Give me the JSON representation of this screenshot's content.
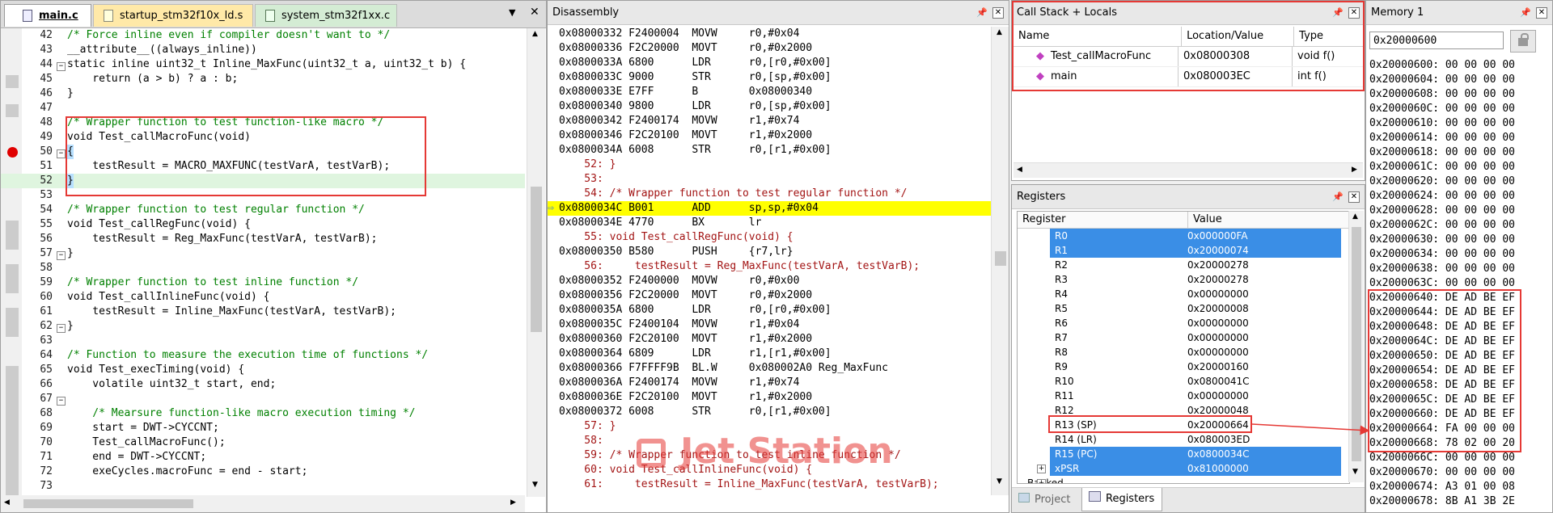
{
  "editor": {
    "tabs": [
      {
        "label": "main.c",
        "active": true
      },
      {
        "label": "startup_stm32f10x_ld.s",
        "active": false
      },
      {
        "label": "system_stm32f1xx.c",
        "active": false
      }
    ],
    "lines": [
      {
        "n": "42",
        "text": "/* Force inline even if compiler doesn't want to */"
      },
      {
        "n": "43",
        "text": "__attribute__((always_inline))"
      },
      {
        "n": "44",
        "text": "static inline uint32_t Inline_MaxFunc(uint32_t a, uint32_t b) {"
      },
      {
        "n": "45",
        "text": "    return (a > b) ? a : b;"
      },
      {
        "n": "46",
        "text": "}"
      },
      {
        "n": "47",
        "text": ""
      },
      {
        "n": "48",
        "text": "/* Wrapper function to test function-like macro */"
      },
      {
        "n": "49",
        "text": "void Test_callMacroFunc(void)"
      },
      {
        "n": "50",
        "text": "{"
      },
      {
        "n": "51",
        "text": "    testResult = MACRO_MAXFUNC(testVarA, testVarB);"
      },
      {
        "n": "52",
        "text": "}"
      },
      {
        "n": "53",
        "text": ""
      },
      {
        "n": "54",
        "text": "/* Wrapper function to test regular function */"
      },
      {
        "n": "55",
        "text": "void Test_callRegFunc(void) {"
      },
      {
        "n": "56",
        "text": "    testResult = Reg_MaxFunc(testVarA, testVarB);"
      },
      {
        "n": "57",
        "text": "}"
      },
      {
        "n": "58",
        "text": ""
      },
      {
        "n": "59",
        "text": "/* Wrapper function to test inline function */"
      },
      {
        "n": "60",
        "text": "void Test_callInlineFunc(void) {"
      },
      {
        "n": "61",
        "text": "    testResult = Inline_MaxFunc(testVarA, testVarB);"
      },
      {
        "n": "62",
        "text": "}"
      },
      {
        "n": "63",
        "text": ""
      },
      {
        "n": "64",
        "text": "/* Function to measure the execution time of functions */"
      },
      {
        "n": "65",
        "text": "void Test_execTiming(void) {"
      },
      {
        "n": "66",
        "text": "    volatile uint32_t start, end;"
      },
      {
        "n": "67",
        "text": ""
      },
      {
        "n": "68",
        "text": "    /* Mearsure function-like macro execution timing */"
      },
      {
        "n": "69",
        "text": "    start = DWT->CYCCNT;"
      },
      {
        "n": "70",
        "text": "    Test_callMacroFunc();"
      },
      {
        "n": "71",
        "text": "    end = DWT->CYCCNT;"
      },
      {
        "n": "72",
        "text": "    exeCycles.macroFunc = end - start;"
      },
      {
        "n": "73",
        "text": ""
      }
    ]
  },
  "disassembly": {
    "title": "Disassembly",
    "lines": [
      {
        "kind": "asm",
        "text": "0x08000332 F2400004  MOVW     r0,#0x04"
      },
      {
        "kind": "asm",
        "text": "0x08000336 F2C20000  MOVT     r0,#0x2000"
      },
      {
        "kind": "asm",
        "text": "0x0800033A 6800      LDR      r0,[r0,#0x00]"
      },
      {
        "kind": "asm",
        "text": "0x0800033C 9000      STR      r0,[sp,#0x00]"
      },
      {
        "kind": "asm",
        "text": "0x0800033E E7FF      B        0x08000340"
      },
      {
        "kind": "asm",
        "text": "0x08000340 9800      LDR      r0,[sp,#0x00]"
      },
      {
        "kind": "asm",
        "text": "0x08000342 F2400174  MOVW     r1,#0x74"
      },
      {
        "kind": "asm",
        "text": "0x08000346 F2C20100  MOVT     r1,#0x2000"
      },
      {
        "kind": "asm",
        "text": "0x0800034A 6008      STR      r0,[r1,#0x00]"
      },
      {
        "kind": "src",
        "text": "    52: }"
      },
      {
        "kind": "src",
        "text": "    53:"
      },
      {
        "kind": "src",
        "text": "    54: /* Wrapper function to test regular function */"
      },
      {
        "kind": "cur",
        "text": "0x0800034C B001      ADD      sp,sp,#0x04"
      },
      {
        "kind": "asm",
        "text": "0x0800034E 4770      BX       lr"
      },
      {
        "kind": "src",
        "text": "    55: void Test_callRegFunc(void) {"
      },
      {
        "kind": "asm",
        "text": "0x08000350 B580      PUSH     {r7,lr}"
      },
      {
        "kind": "src",
        "text": "    56:     testResult = Reg_MaxFunc(testVarA, testVarB);"
      },
      {
        "kind": "asm",
        "text": "0x08000352 F2400000  MOVW     r0,#0x00"
      },
      {
        "kind": "asm",
        "text": "0x08000356 F2C20000  MOVT     r0,#0x2000"
      },
      {
        "kind": "asm",
        "text": "0x0800035A 6800      LDR      r0,[r0,#0x00]"
      },
      {
        "kind": "asm",
        "text": "0x0800035C F2400104  MOVW     r1,#0x04"
      },
      {
        "kind": "asm",
        "text": "0x08000360 F2C20100  MOVT     r1,#0x2000"
      },
      {
        "kind": "asm",
        "text": "0x08000364 6809      LDR      r1,[r1,#0x00]"
      },
      {
        "kind": "asm",
        "text": "0x08000366 F7FFFF9B  BL.W     0x080002A0 Reg_MaxFunc"
      },
      {
        "kind": "asm",
        "text": "0x0800036A F2400174  MOVW     r1,#0x74"
      },
      {
        "kind": "asm",
        "text": "0x0800036E F2C20100  MOVT     r1,#0x2000"
      },
      {
        "kind": "asm",
        "text": "0x08000372 6008      STR      r0,[r1,#0x00]"
      },
      {
        "kind": "src",
        "text": "    57: }"
      },
      {
        "kind": "src",
        "text": "    58:"
      },
      {
        "kind": "src",
        "text": "    59: /* Wrapper function to test inline function */"
      },
      {
        "kind": "src",
        "text": "    60: void Test_callInlineFunc(void) {"
      },
      {
        "kind": "src",
        "text": "    61:     testResult = Inline_MaxFunc(testVarA, testVarB);"
      }
    ]
  },
  "callstack": {
    "title": "Call Stack + Locals",
    "headers": [
      "Name",
      "Location/Value",
      "Type"
    ],
    "rows": [
      {
        "name": "Test_callMacroFunc",
        "loc": "0x08000308",
        "type": "void f()"
      },
      {
        "name": "main",
        "loc": "0x080003EC",
        "type": "int f()"
      }
    ]
  },
  "registers": {
    "title": "Registers",
    "headers": [
      "Register",
      "Value"
    ],
    "rows": [
      {
        "name": "R0",
        "value": "0x000000FA",
        "sel": true
      },
      {
        "name": "R1",
        "value": "0x20000074",
        "sel": true
      },
      {
        "name": "R2",
        "value": "0x20000278",
        "sel": false
      },
      {
        "name": "R3",
        "value": "0x20000278",
        "sel": false
      },
      {
        "name": "R4",
        "value": "0x00000000",
        "sel": false
      },
      {
        "name": "R5",
        "value": "0x20000008",
        "sel": false
      },
      {
        "name": "R6",
        "value": "0x00000000",
        "sel": false
      },
      {
        "name": "R7",
        "value": "0x00000000",
        "sel": false
      },
      {
        "name": "R8",
        "value": "0x00000000",
        "sel": false
      },
      {
        "name": "R9",
        "value": "0x20000160",
        "sel": false
      },
      {
        "name": "R10",
        "value": "0x0800041C",
        "sel": false
      },
      {
        "name": "R11",
        "value": "0x00000000",
        "sel": false
      },
      {
        "name": "R12",
        "value": "0x20000048",
        "sel": false
      },
      {
        "name": "R13 (SP)",
        "value": "0x20000664",
        "sel": false
      },
      {
        "name": "R14 (LR)",
        "value": "0x080003ED",
        "sel": false
      },
      {
        "name": "R15 (PC)",
        "value": "0x0800034C",
        "sel": true
      },
      {
        "name": "xPSR",
        "value": "0x81000000",
        "sel": true
      },
      {
        "name": "Banked",
        "value": "",
        "sel": false
      }
    ],
    "bottom_tabs": [
      "Project",
      "Registers"
    ]
  },
  "memory": {
    "title": "Memory 1",
    "address": "0x20000600",
    "lines": [
      "0x20000600: 00 00 00 00",
      "0x20000604: 00 00 00 00",
      "0x20000608: 00 00 00 00",
      "0x2000060C: 00 00 00 00",
      "0x20000610: 00 00 00 00",
      "0x20000614: 00 00 00 00",
      "0x20000618: 00 00 00 00",
      "0x2000061C: 00 00 00 00",
      "0x20000620: 00 00 00 00",
      "0x20000624: 00 00 00 00",
      "0x20000628: 00 00 00 00",
      "0x2000062C: 00 00 00 00",
      "0x20000630: 00 00 00 00",
      "0x20000634: 00 00 00 00",
      "0x20000638: 00 00 00 00",
      "0x2000063C: 00 00 00 00",
      "0x20000640: DE AD BE EF",
      "0x20000644: DE AD BE EF",
      "0x20000648: DE AD BE EF",
      "0x2000064C: DE AD BE EF",
      "0x20000650: DE AD BE EF",
      "0x20000654: DE AD BE EF",
      "0x20000658: DE AD BE EF",
      "0x2000065C: DE AD BE EF",
      "0x20000660: DE AD BE EF",
      "0x20000664: FA 00 00 00",
      "0x20000668: 78 02 00 20",
      "0x2000066C: 00 00 00 00",
      "0x20000670: 00 00 00 00",
      "0x20000674: A3 01 00 08",
      "0x20000678: 8B A1 3B 2E"
    ]
  },
  "watermark": "Jet Station",
  "colors": {
    "annotation": "#e53935",
    "selection": "#3a8ee6",
    "current_line": "#ffff00",
    "comment": "#008000",
    "keyword": "#0000ff"
  }
}
